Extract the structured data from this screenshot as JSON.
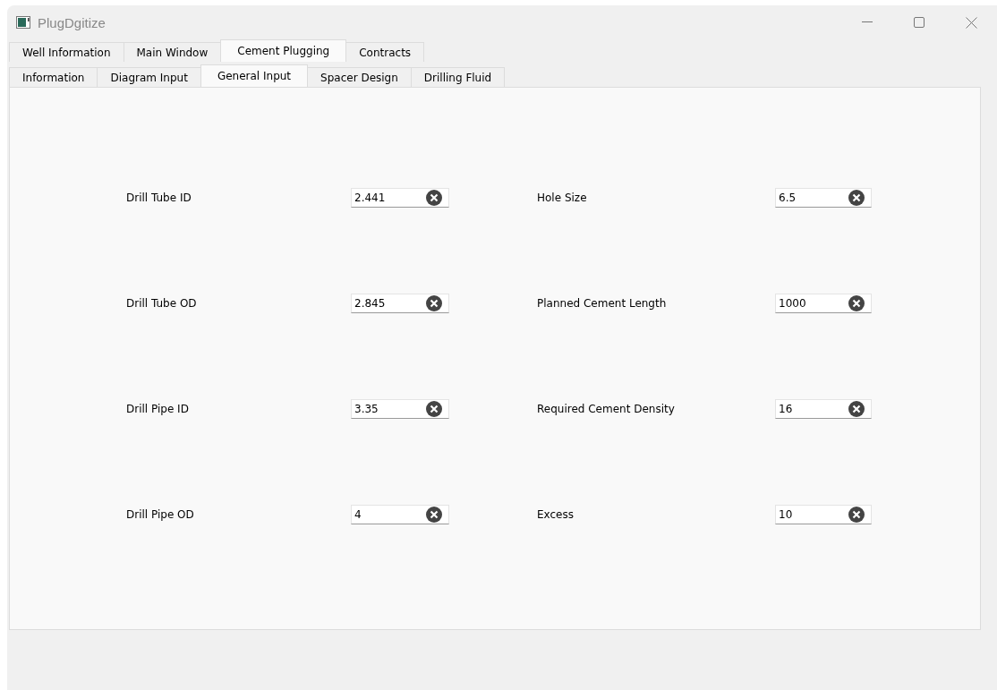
{
  "window": {
    "title": "PlugDgitize"
  },
  "tabs": [
    {
      "label": "Well Information",
      "selected": false
    },
    {
      "label": "Main Window",
      "selected": false
    },
    {
      "label": "Cement Plugging",
      "selected": true
    },
    {
      "label": "Contracts",
      "selected": false
    }
  ],
  "sub_tabs": [
    {
      "label": "Information",
      "selected": false
    },
    {
      "label": "Diagram Input",
      "selected": false
    },
    {
      "label": "General Input",
      "selected": true
    },
    {
      "label": "Spacer Design",
      "selected": false
    },
    {
      "label": "Drilling Fluid",
      "selected": false
    }
  ],
  "left_fields": [
    {
      "label": "Drill Tube ID",
      "value": "2.441"
    },
    {
      "label": "Drill Tube OD",
      "value": "2.845"
    },
    {
      "label": "Drill Pipe ID",
      "value": "3.35"
    },
    {
      "label": "Drill Pipe OD",
      "value": "4"
    }
  ],
  "right_fields": [
    {
      "label": "Hole Size",
      "value": "6.5"
    },
    {
      "label": "Planned Cement Length",
      "value": "1000"
    },
    {
      "label": "Required Cement Density",
      "value": "16"
    },
    {
      "label": "Excess",
      "value": "10"
    }
  ]
}
